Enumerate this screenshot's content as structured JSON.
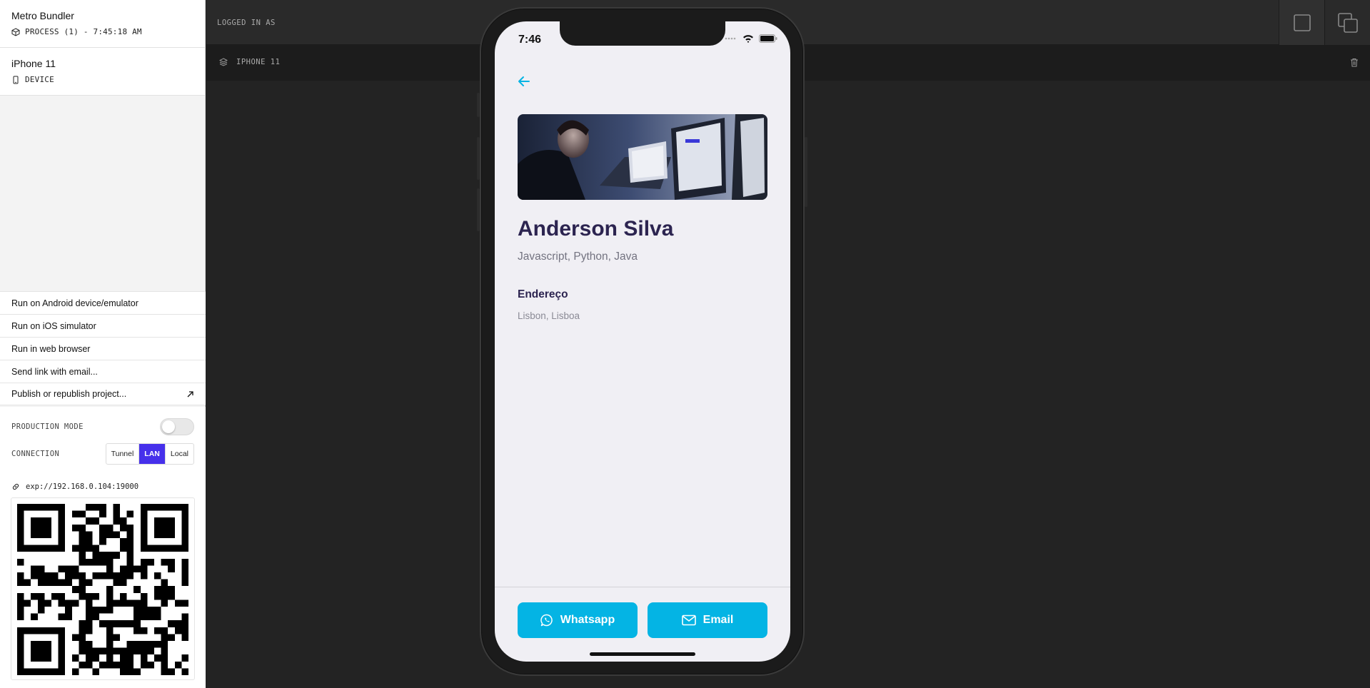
{
  "sidebar": {
    "process": {
      "title": "Metro Bundler",
      "subtitle": "PROCESS (1) - 7:45:18 AM"
    },
    "device": {
      "title": "iPhone 11",
      "subtitle": "DEVICE"
    },
    "actions": [
      {
        "label": "Run on Android device/emulator"
      },
      {
        "label": "Run on iOS simulator"
      },
      {
        "label": "Run in web browser"
      },
      {
        "label": "Send link with email..."
      },
      {
        "label": "Publish or republish project..."
      }
    ],
    "production_mode_label": "PRODUCTION MODE",
    "production_mode_on": false,
    "connection_label": "CONNECTION",
    "connection_options": [
      "Tunnel",
      "LAN",
      "Local"
    ],
    "connection_selected": "LAN",
    "url": "exp://192.168.0.104:19000",
    "accent_color": "#4630eb"
  },
  "topbar": {
    "logged_in_label": "LOGGED IN AS"
  },
  "devbar": {
    "device_label": "IPHONE 11"
  },
  "phone": {
    "status_time": "7:46",
    "profile": {
      "name": "Anderson Silva",
      "skills": "Javascript, Python, Java",
      "address_title": "Endereço",
      "address": "Lisbon, Lisboa"
    },
    "buttons": {
      "whatsapp": "Whatsapp",
      "email": "Email"
    },
    "button_color": "#04b4e4",
    "title_color": "#2c2450"
  }
}
